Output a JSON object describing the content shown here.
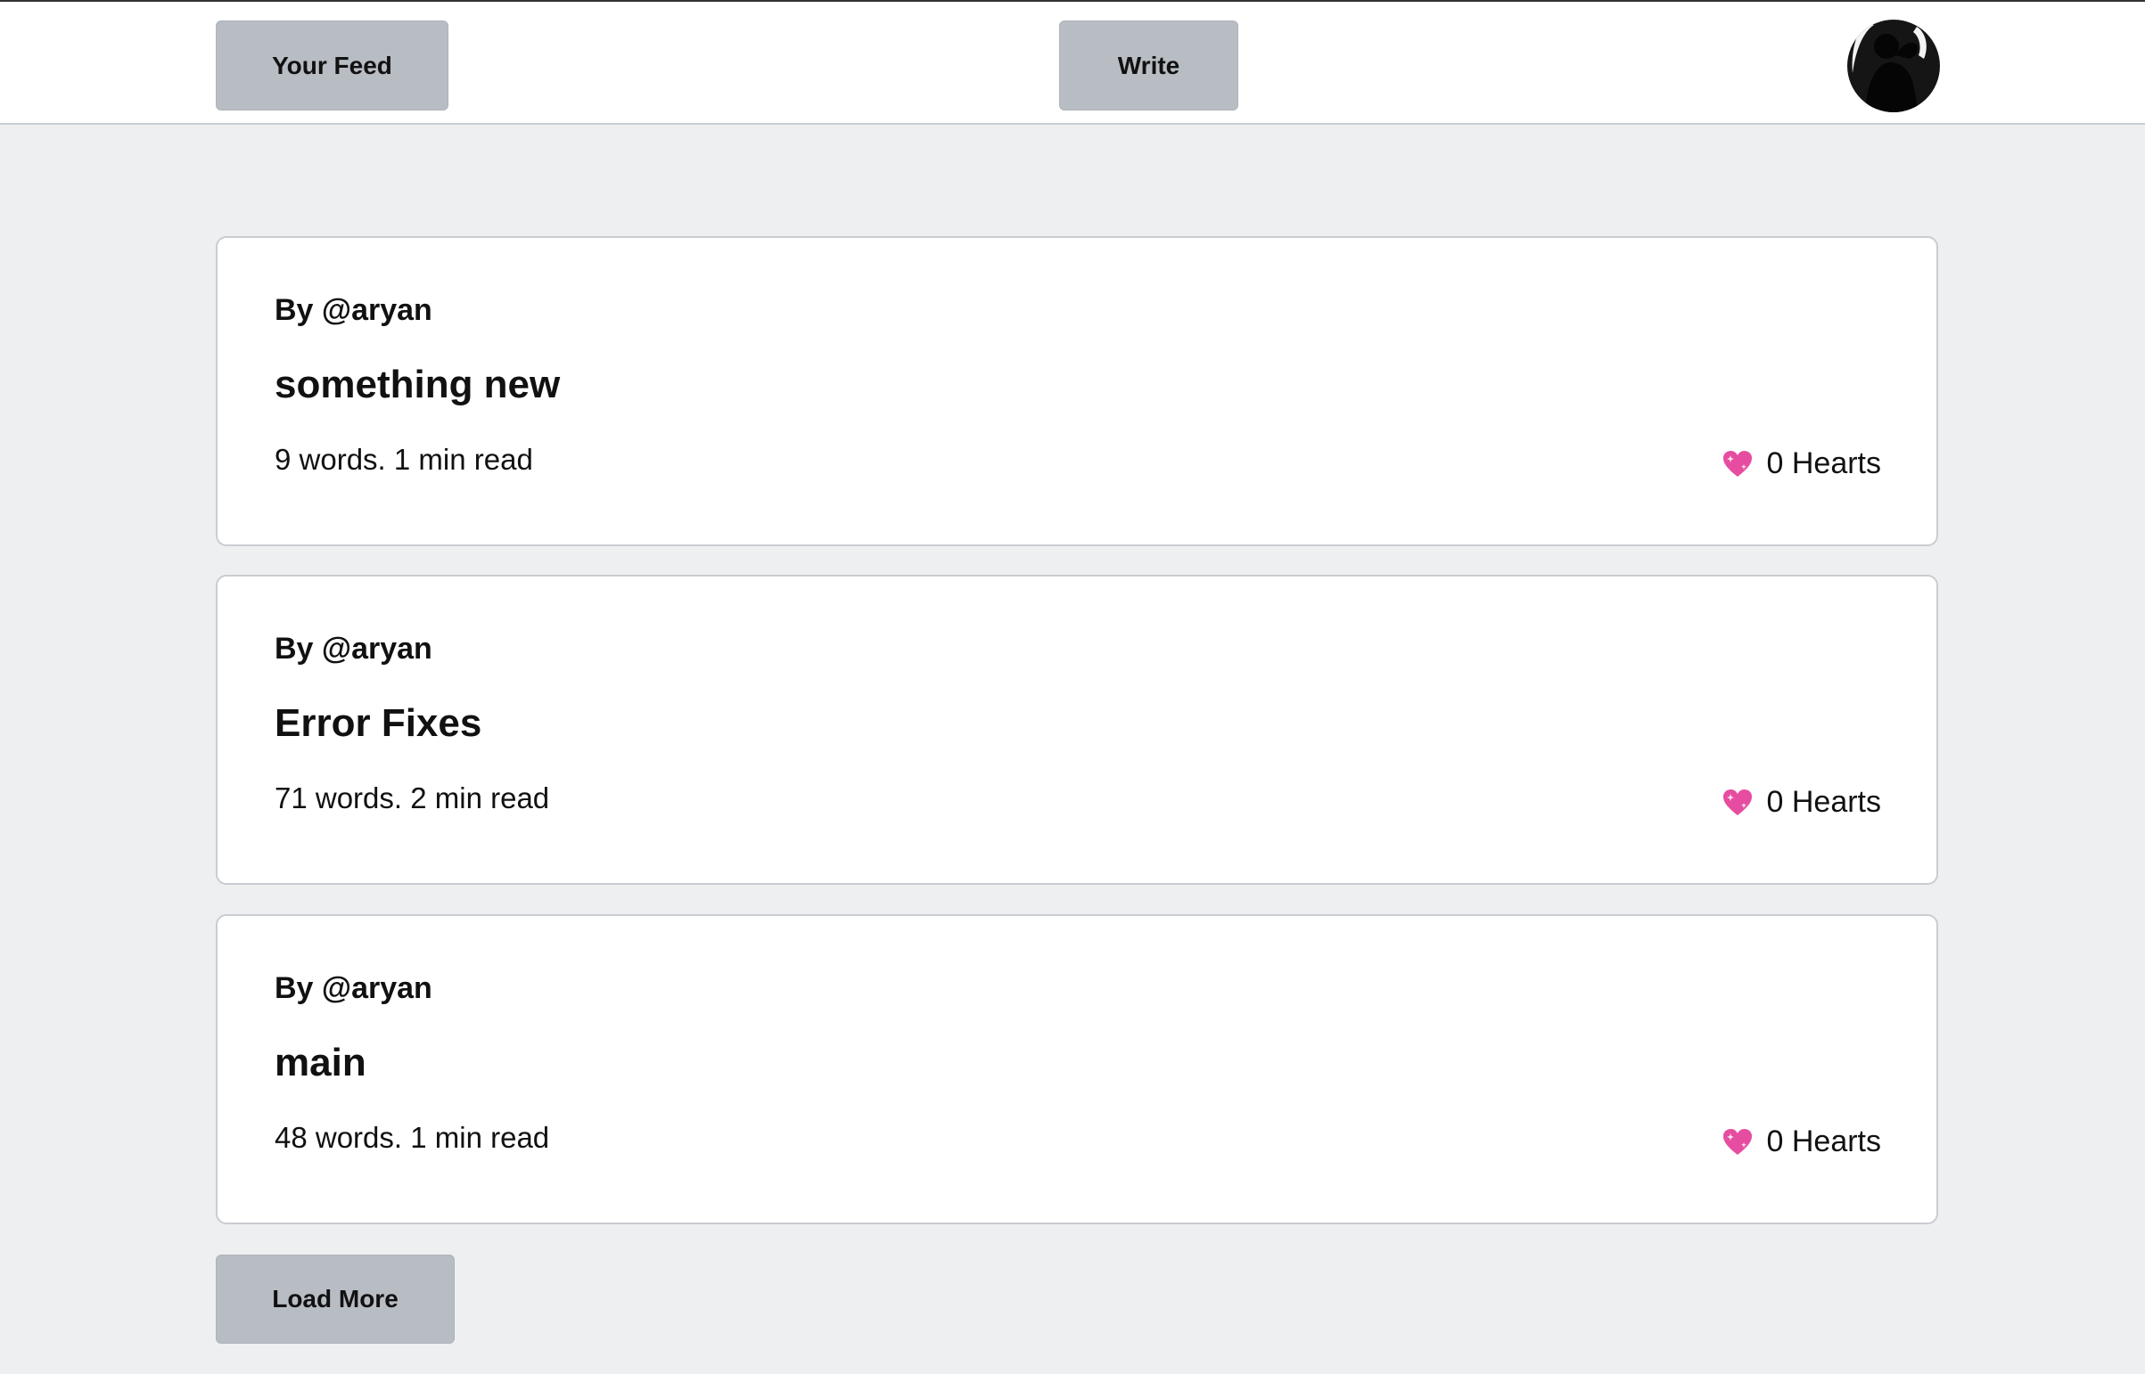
{
  "topbar": {
    "your_feed_label": "Your Feed",
    "write_label": "Write",
    "avatar_icon": "profile-avatar-icon"
  },
  "posts": [
    {
      "author": "By @aryan",
      "title": "something new",
      "meta": "9 words. 1 min read",
      "hearts": "0 Hearts"
    },
    {
      "author": "By @aryan",
      "title": "Error Fixes",
      "meta": "71 words. 2 min read",
      "hearts": "0 Hearts"
    },
    {
      "author": "By @aryan",
      "title": "main",
      "meta": "48 words. 1 min read",
      "hearts": "0 Hearts"
    }
  ],
  "load_more_label": "Load More",
  "colors": {
    "page_bg": "#eeeff1",
    "button_bg": "#b8bcc3",
    "heart": "#e64da0"
  }
}
